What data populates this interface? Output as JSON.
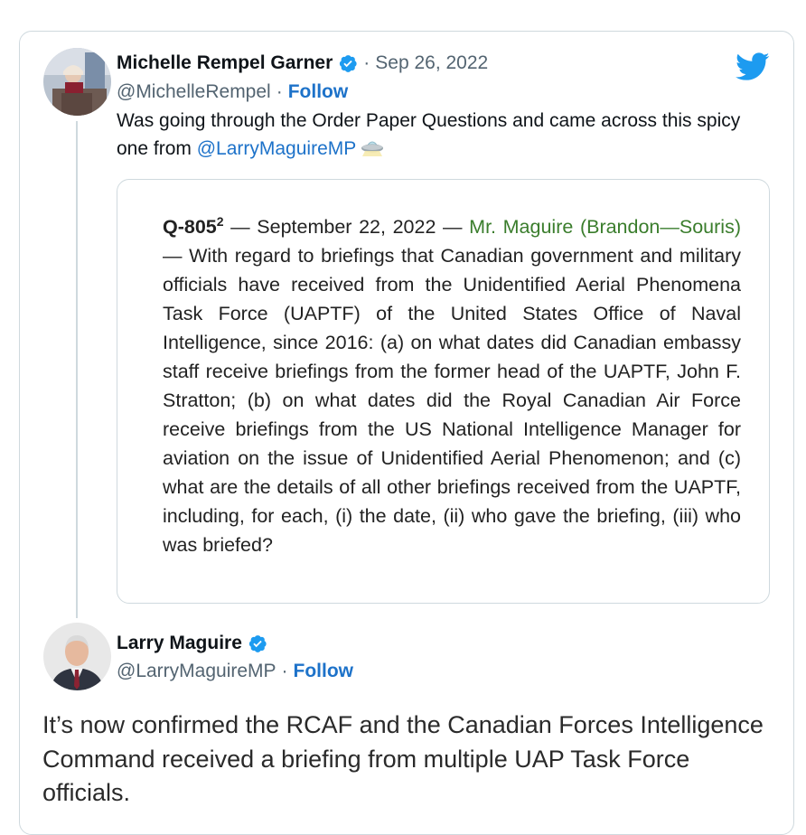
{
  "tweet1": {
    "author_name": "Michelle Rempel Garner",
    "date": "Sep 26, 2022",
    "handle": "@MichelleRempel",
    "follow_label": "Follow",
    "text_before": "Was going through the Order Paper Questions and came across this spicy one from ",
    "mention": "@LarryMaguireMP",
    "emoji_icon": "flying-saucer-icon"
  },
  "quote": {
    "question_number": "Q-805",
    "question_superscript": "2",
    "date_part": " — September 22, 2022 — ",
    "member": "Mr. Maguire (Brandon—Souris)",
    "body": " — With regard to briefings that Canadian government and military officials have received from the Unidentified Aerial Phenomena Task Force (UAPTF) of the United States Office of Naval Intelligence, since 2016: (a) on what dates did Canadian embassy staff receive briefings from the former head of the UAPTF, John F. Stratton; (b) on what dates did the Royal Canadian Air Force receive briefings from the US National Intelligence Manager for aviation on the issue of Unidentified Aerial Phenomenon; and (c) what are the details of all other briefings received from the UAPTF, including, for each, (i) the date, (ii) who gave the briefing, (iii) who was briefed?"
  },
  "tweet2": {
    "author_name": "Larry Maguire",
    "handle": "@LarryMaguireMP",
    "follow_label": "Follow",
    "text": "It’s now confirmed the RCAF and the Canadian Forces Intelligence Command received a briefing from multiple UAP Task Force officials."
  },
  "separators": {
    "dot": "·"
  },
  "colors": {
    "link": "#1d72c9",
    "verified": "#1d9bf0",
    "twitter": "#1d9bf0",
    "member": "#3a7d2c",
    "border": "#cfd9de",
    "muted": "#536471"
  }
}
